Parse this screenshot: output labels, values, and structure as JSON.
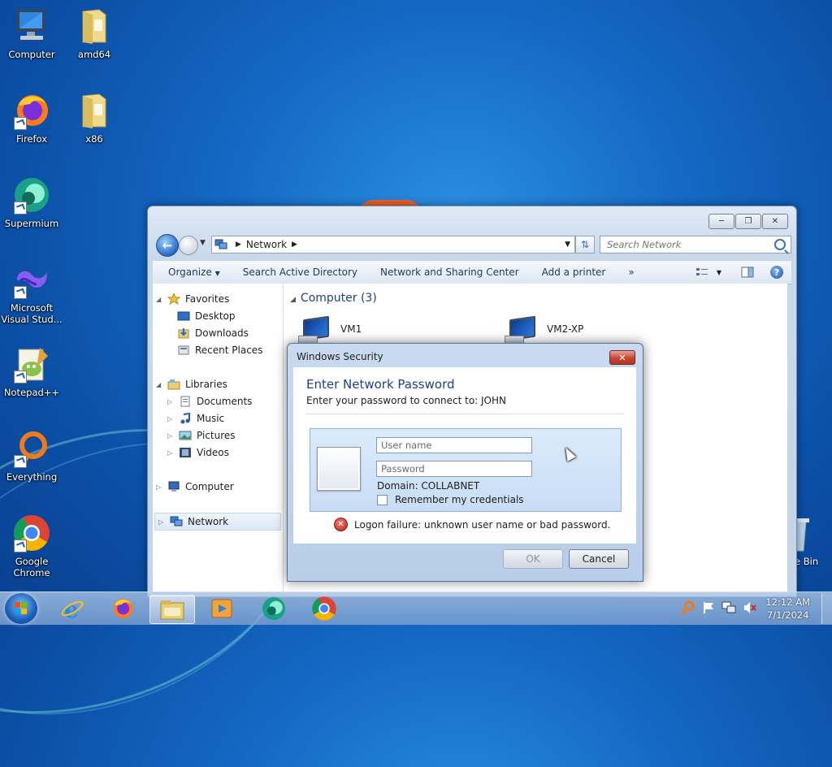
{
  "desktop": {
    "icons": [
      {
        "label": "Computer"
      },
      {
        "label": "amd64"
      },
      {
        "label": "Firefox"
      },
      {
        "label": "x86"
      },
      {
        "label": "Supermium"
      },
      {
        "label": "Microsoft Visual Stud..."
      },
      {
        "label": "Notepad++"
      },
      {
        "label": "Everything"
      },
      {
        "label": "Google Chrome"
      }
    ],
    "recycle_label": "e Bin"
  },
  "explorer": {
    "address": {
      "location": "Network"
    },
    "search": {
      "placeholder": "Search Network"
    },
    "toolbar": {
      "organize": "Organize",
      "search_ad": "Search Active Directory",
      "network_sharing": "Network and Sharing Center",
      "add_printer": "Add a printer",
      "more": "»"
    },
    "nav": {
      "favorites": "Favorites",
      "desktop": "Desktop",
      "downloads": "Downloads",
      "recent_places": "Recent Places",
      "libraries": "Libraries",
      "documents": "Documents",
      "music": "Music",
      "pictures": "Pictures",
      "videos": "Videos",
      "computer": "Computer",
      "network": "Network"
    },
    "content": {
      "group_title": "Computer (3)",
      "computers": [
        {
          "name": "VM1"
        },
        {
          "name": "VM2-XP"
        }
      ]
    }
  },
  "dialog": {
    "title": "Windows Security",
    "heading": "Enter Network Password",
    "subtext": "Enter your password to connect to: JOHN",
    "username_placeholder": "User name",
    "password_placeholder": "Password",
    "domain": "Domain: COLLABNET",
    "remember": "Remember my credentials",
    "error": "Logon failure: unknown user name or bad password.",
    "ok": "OK",
    "cancel": "Cancel"
  },
  "taskbar": {
    "time": "12:12 AM",
    "date": "7/1/2024"
  },
  "colors": {
    "accent": "#1e3f8a",
    "error": "#c3261a",
    "desktop": "#1569c4"
  }
}
